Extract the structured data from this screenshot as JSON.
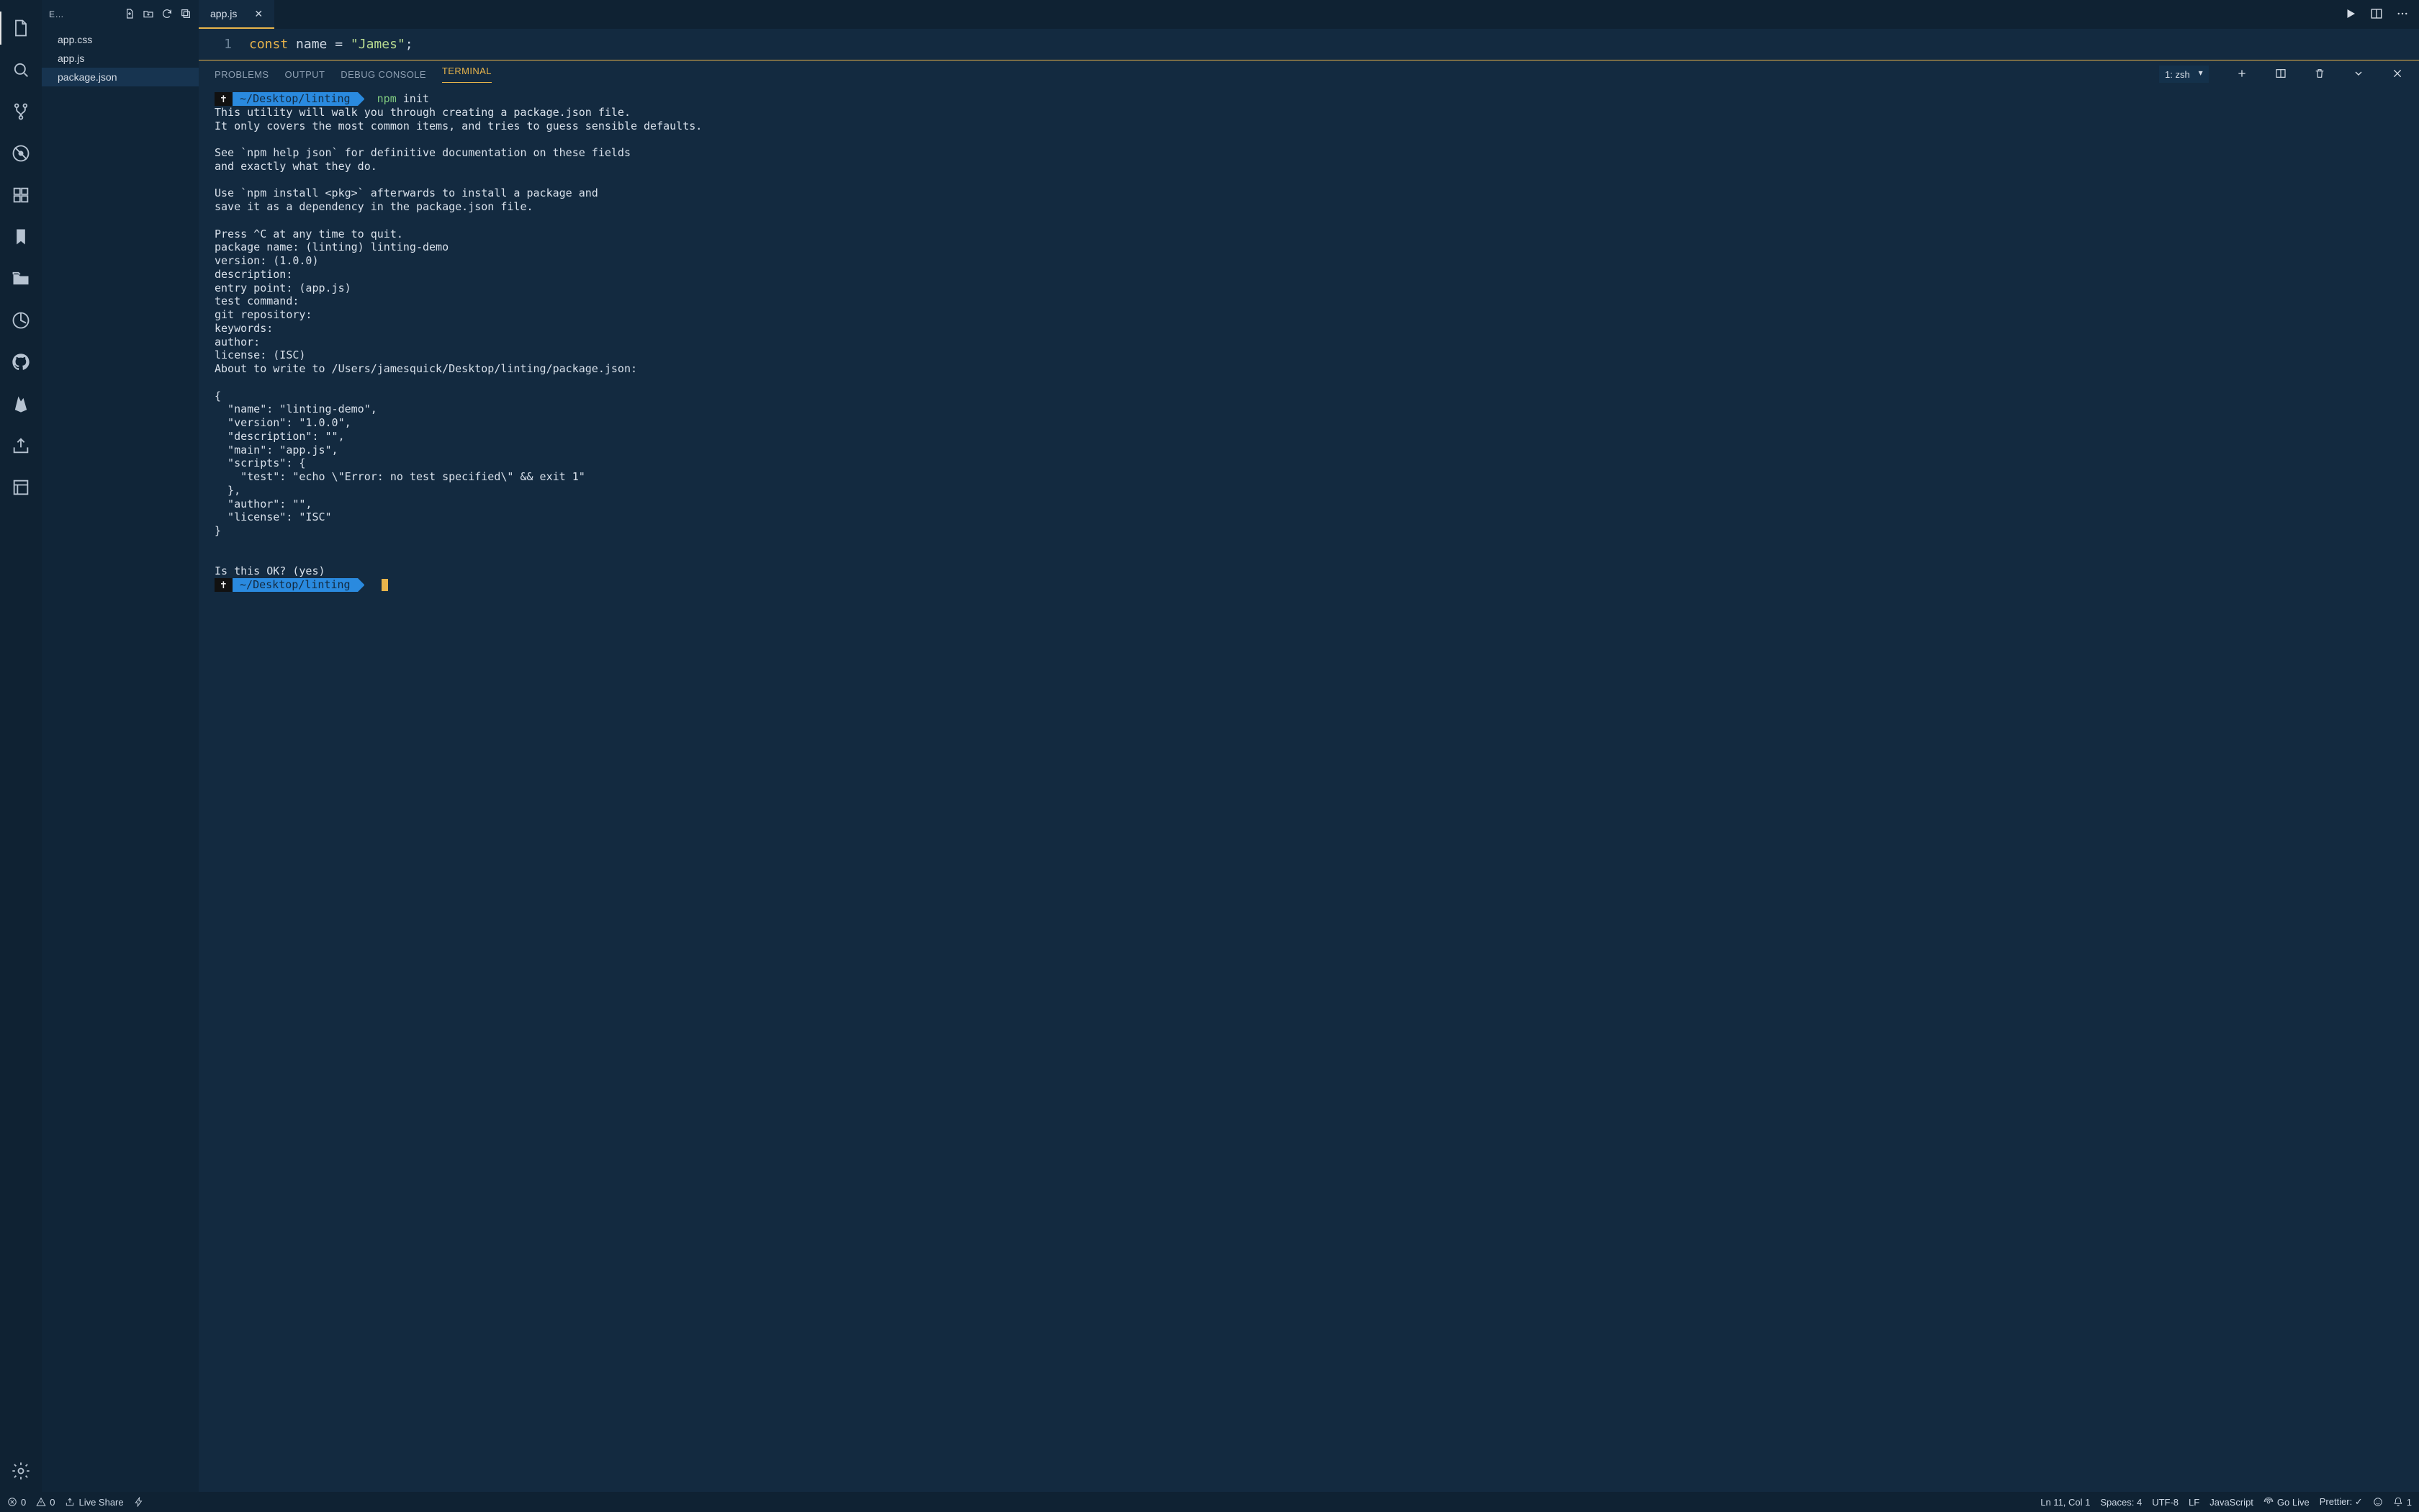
{
  "sidebar_header": {
    "title": "E…"
  },
  "files": [
    {
      "name": "app.css"
    },
    {
      "name": "app.js"
    },
    {
      "name": "package.json"
    }
  ],
  "files_selected_index": 2,
  "tab": {
    "label": "app.js"
  },
  "editor": {
    "line_number": "1",
    "tok_const": "const",
    "tok_ident": "name",
    "tok_eq": "=",
    "tok_string": "\"James\"",
    "tok_semi": ";"
  },
  "panel_tabs": {
    "problems": "PROBLEMS",
    "output": "OUTPUT",
    "debug": "DEBUG CONSOLE",
    "terminal": "TERMINAL"
  },
  "terminal_selector": "1: zsh",
  "prompt": {
    "user_seg": "✝",
    "path_seg": "~/Desktop/linting",
    "cmd_bin": "npm",
    "cmd_arg": "init"
  },
  "terminal_body": "This utility will walk you through creating a package.json file.\nIt only covers the most common items, and tries to guess sensible defaults.\n\nSee `npm help json` for definitive documentation on these fields\nand exactly what they do.\n\nUse `npm install <pkg>` afterwards to install a package and\nsave it as a dependency in the package.json file.\n\nPress ^C at any time to quit.\npackage name: (linting) linting-demo\nversion: (1.0.0) \ndescription: \nentry point: (app.js) \ntest command: \ngit repository: \nkeywords: \nauthor: \nlicense: (ISC) \nAbout to write to /Users/jamesquick/Desktop/linting/package.json:\n\n{\n  \"name\": \"linting-demo\",\n  \"version\": \"1.0.0\",\n  \"description\": \"\",\n  \"main\": \"app.js\",\n  \"scripts\": {\n    \"test\": \"echo \\\"Error: no test specified\\\" && exit 1\"\n  },\n  \"author\": \"\",\n  \"license\": \"ISC\"\n}\n\n\nIs this OK? (yes) ",
  "status": {
    "errors": "0",
    "warnings": "0",
    "live_share": "Live Share",
    "ln_col": "Ln 11, Col 1",
    "spaces": "Spaces: 4",
    "encoding": "UTF-8",
    "eol": "LF",
    "language": "JavaScript",
    "go_live": "Go Live",
    "prettier": "Prettier: ✓",
    "bell": "1"
  }
}
